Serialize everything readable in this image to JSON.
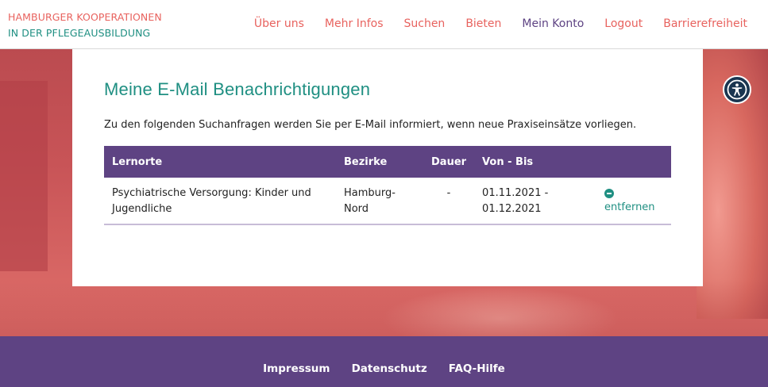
{
  "header": {
    "logo_line1": "HAMBURGER KOOPERATIONEN",
    "logo_line2": "IN DER PFLEGEAUSBILDUNG",
    "nav": [
      {
        "label": "Über uns"
      },
      {
        "label": "Mehr Infos"
      },
      {
        "label": "Suchen"
      },
      {
        "label": "Bieten"
      },
      {
        "label": "Mein Konto"
      },
      {
        "label": "Logout"
      },
      {
        "label": "Barrierefreiheit"
      }
    ]
  },
  "accessibility_button": {
    "icon": "accessibility-icon"
  },
  "main": {
    "title": "Meine E-Mail Benachrichtigungen",
    "description": "Zu den folgenden Suchanfragen werden Sie per E-Mail informiert, wenn neue Praxiseinsätze vorliegen.",
    "table": {
      "headers": [
        "Lernorte",
        "Bezirke",
        "Dauer",
        "Von - Bis",
        ""
      ],
      "rows": [
        {
          "lernorte": "Psychiatrische Versorgung: Kinder und Jugendliche",
          "bezirke": "Hamburg-Nord",
          "dauer": "-",
          "von_bis": "01.11.2021 - 01.12.2021",
          "action": "entfernen"
        }
      ]
    }
  },
  "footer": {
    "links": [
      {
        "label": "Impressum"
      },
      {
        "label": "Datenschutz"
      },
      {
        "label": "FAQ-Hilfe"
      }
    ]
  },
  "colors": {
    "brand_coral": "#e8625e",
    "brand_teal": "#1f8f82",
    "brand_purple": "#5e4383"
  }
}
